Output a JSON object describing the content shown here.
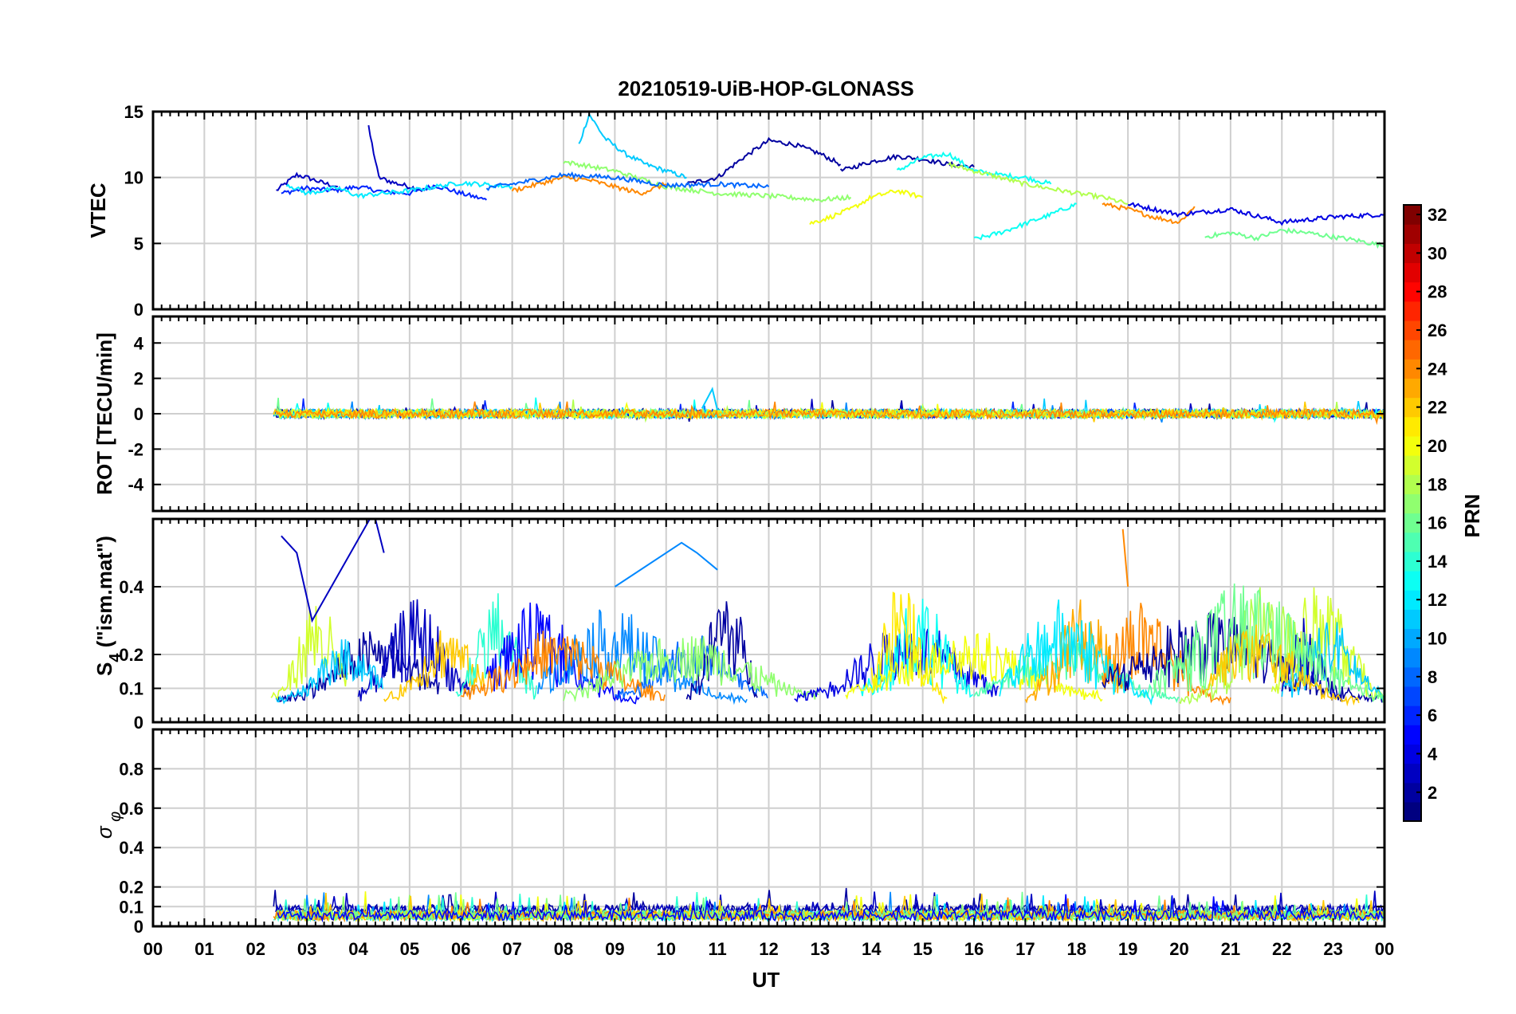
{
  "chart_data": [
    {
      "type": "line",
      "title": "20210519-UiB-HOP-GLONASS",
      "ylabel": "VTEC",
      "ylim": [
        0,
        15
      ],
      "yticks": [
        0,
        5,
        10,
        15
      ],
      "xlabel": "",
      "x_units": "hour UT",
      "series": [
        {
          "prn": 3,
          "x": [
            2.4,
            2.6,
            2.8,
            3.0,
            3.3,
            3.6
          ],
          "y": [
            9.0,
            9.6,
            10.2,
            10.0,
            9.6,
            9.3
          ]
        },
        {
          "prn": 3,
          "x": [
            4.2,
            4.4,
            4.7,
            5.0,
            5.3
          ],
          "y": [
            13.8,
            10.0,
            9.6,
            9.3,
            9.0
          ]
        },
        {
          "prn": 6,
          "x": [
            2.5,
            3.0,
            3.5,
            4.0,
            4.5,
            5.0,
            5.5,
            6.0,
            6.5
          ],
          "y": [
            8.8,
            9.2,
            9.0,
            9.3,
            8.9,
            8.8,
            9.4,
            8.8,
            8.3
          ]
        },
        {
          "prn": 11,
          "x": [
            8.3,
            8.5,
            8.8,
            9.2,
            9.6,
            10.0,
            10.4
          ],
          "y": [
            12.5,
            14.8,
            13.0,
            11.8,
            11.0,
            10.5,
            10.0
          ]
        },
        {
          "prn": 2,
          "x": [
            10.4,
            11.0,
            11.5,
            12.0,
            12.5,
            13.0,
            13.4
          ],
          "y": [
            9.5,
            10.0,
            11.5,
            12.8,
            12.5,
            11.8,
            11.0
          ]
        },
        {
          "prn": 2,
          "x": [
            13.4,
            14.0,
            14.5,
            15.0,
            15.5,
            16.0
          ],
          "y": [
            10.5,
            11.2,
            11.6,
            11.4,
            11.0,
            10.8
          ]
        },
        {
          "prn": 13,
          "x": [
            14.5,
            15.0,
            15.5,
            16.0,
            16.5,
            17.0,
            17.5
          ],
          "y": [
            10.5,
            11.5,
            11.8,
            10.5,
            10.2,
            10.0,
            9.5
          ]
        },
        {
          "prn": 18,
          "x": [
            15.5,
            16.0,
            17.0,
            18.0,
            18.5,
            19.0
          ],
          "y": [
            11.0,
            10.5,
            9.5,
            8.8,
            8.5,
            8.0
          ]
        },
        {
          "prn": 13,
          "x": [
            16.0,
            16.5,
            17.0,
            17.5,
            18.0
          ],
          "y": [
            5.3,
            5.8,
            6.5,
            7.2,
            8.0
          ]
        },
        {
          "prn": 24,
          "x": [
            18.5,
            19.0,
            19.5,
            20.0,
            20.3
          ],
          "y": [
            8.0,
            7.6,
            7.0,
            6.6,
            7.8
          ]
        },
        {
          "prn": 4,
          "x": [
            19.0,
            20.0,
            21.0,
            22.0,
            23.0,
            24.0
          ],
          "y": [
            8.0,
            7.2,
            7.6,
            6.6,
            7.0,
            7.2
          ]
        },
        {
          "prn": 20,
          "x": [
            12.8,
            13.2,
            13.6,
            14.0,
            14.5,
            15.0
          ],
          "y": [
            6.5,
            7.0,
            7.6,
            8.5,
            9.0,
            8.5
          ]
        },
        {
          "prn": 16,
          "x": [
            20.5,
            21.0,
            21.5,
            22.0,
            22.5,
            23.0,
            23.5,
            24.0
          ],
          "y": [
            5.5,
            5.8,
            5.4,
            6.0,
            5.8,
            5.5,
            5.2,
            4.8
          ]
        },
        {
          "prn": 12,
          "x": [
            2.6,
            3.0,
            3.6,
            4.0,
            5.0,
            6.0,
            7.0
          ],
          "y": [
            9.5,
            8.8,
            9.2,
            8.6,
            9.0,
            9.6,
            9.3
          ]
        },
        {
          "prn": 17,
          "x": [
            8.0,
            9.0,
            10.0,
            11.0,
            12.0,
            13.0,
            13.6
          ],
          "y": [
            11.2,
            10.5,
            9.3,
            8.8,
            8.6,
            8.3,
            8.5
          ]
        },
        {
          "prn": 24,
          "x": [
            7.0,
            7.5,
            8.0,
            8.5,
            9.0,
            9.5,
            10.0
          ],
          "y": [
            9.0,
            9.5,
            10.0,
            9.8,
            9.3,
            8.8,
            9.5
          ]
        },
        {
          "prn": 8,
          "x": [
            6.5,
            7.0,
            8.0,
            9.0,
            10.0,
            11.0,
            12.0
          ],
          "y": [
            9.2,
            9.5,
            10.2,
            10.0,
            9.4,
            9.5,
            9.3
          ]
        }
      ]
    },
    {
      "type": "line",
      "ylabel": "ROT [TECU/min]",
      "ylim": [
        -5.5,
        5.5
      ],
      "yticks": [
        -4,
        -2,
        0,
        2,
        4
      ],
      "notes": "noisy values around 0 for all PRNs; peak near 11 UT about 1.4",
      "series": [
        {
          "prn": 3,
          "x": [
            2.4,
            24.0
          ],
          "y": [
            0.0,
            0.0
          ]
        },
        {
          "prn": 11,
          "x": [
            10.7,
            10.9,
            11.0
          ],
          "y": [
            0.3,
            1.4,
            0.2
          ]
        }
      ]
    },
    {
      "type": "line",
      "ylabel": "S_4 (\"ism.mat\")",
      "ylim": [
        0,
        0.6
      ],
      "yticks": [
        0,
        0.1,
        0.2,
        0.4
      ],
      "notes": "noisy scintillation bursts, values mostly 0.05 to 0.5",
      "series": [
        {
          "prn": 3,
          "x": [
            2.5,
            2.8,
            3.1,
            4.3,
            4.5
          ],
          "y": [
            0.55,
            0.5,
            0.3,
            0.62,
            0.5
          ]
        },
        {
          "prn": 9,
          "x": [
            9.0,
            10.3,
            10.6,
            11.0
          ],
          "y": [
            0.4,
            0.53,
            0.5,
            0.45
          ]
        },
        {
          "prn": 24,
          "x": [
            18.9,
            19.0
          ],
          "y": [
            0.57,
            0.4
          ]
        }
      ]
    },
    {
      "type": "line",
      "ylabel": "σ_φ",
      "ylim": [
        0,
        1
      ],
      "yticks": [
        0,
        0.1,
        0.2,
        0.4,
        0.6,
        0.8
      ],
      "xlabel": "UT",
      "xlim": [
        0,
        24
      ],
      "xticks": [
        "00",
        "01",
        "02",
        "03",
        "04",
        "05",
        "06",
        "07",
        "08",
        "09",
        "10",
        "11",
        "12",
        "13",
        "14",
        "15",
        "16",
        "17",
        "18",
        "19",
        "20",
        "21",
        "22",
        "23",
        "00"
      ],
      "notes": "noisy values mostly below 0.2 from 02:20 UT onward",
      "series": []
    }
  ],
  "colorbar": {
    "label": "PRN",
    "range": [
      1,
      32
    ],
    "ticks": [
      2,
      4,
      6,
      8,
      10,
      12,
      14,
      16,
      18,
      20,
      22,
      24,
      26,
      28,
      30,
      32
    ]
  }
}
